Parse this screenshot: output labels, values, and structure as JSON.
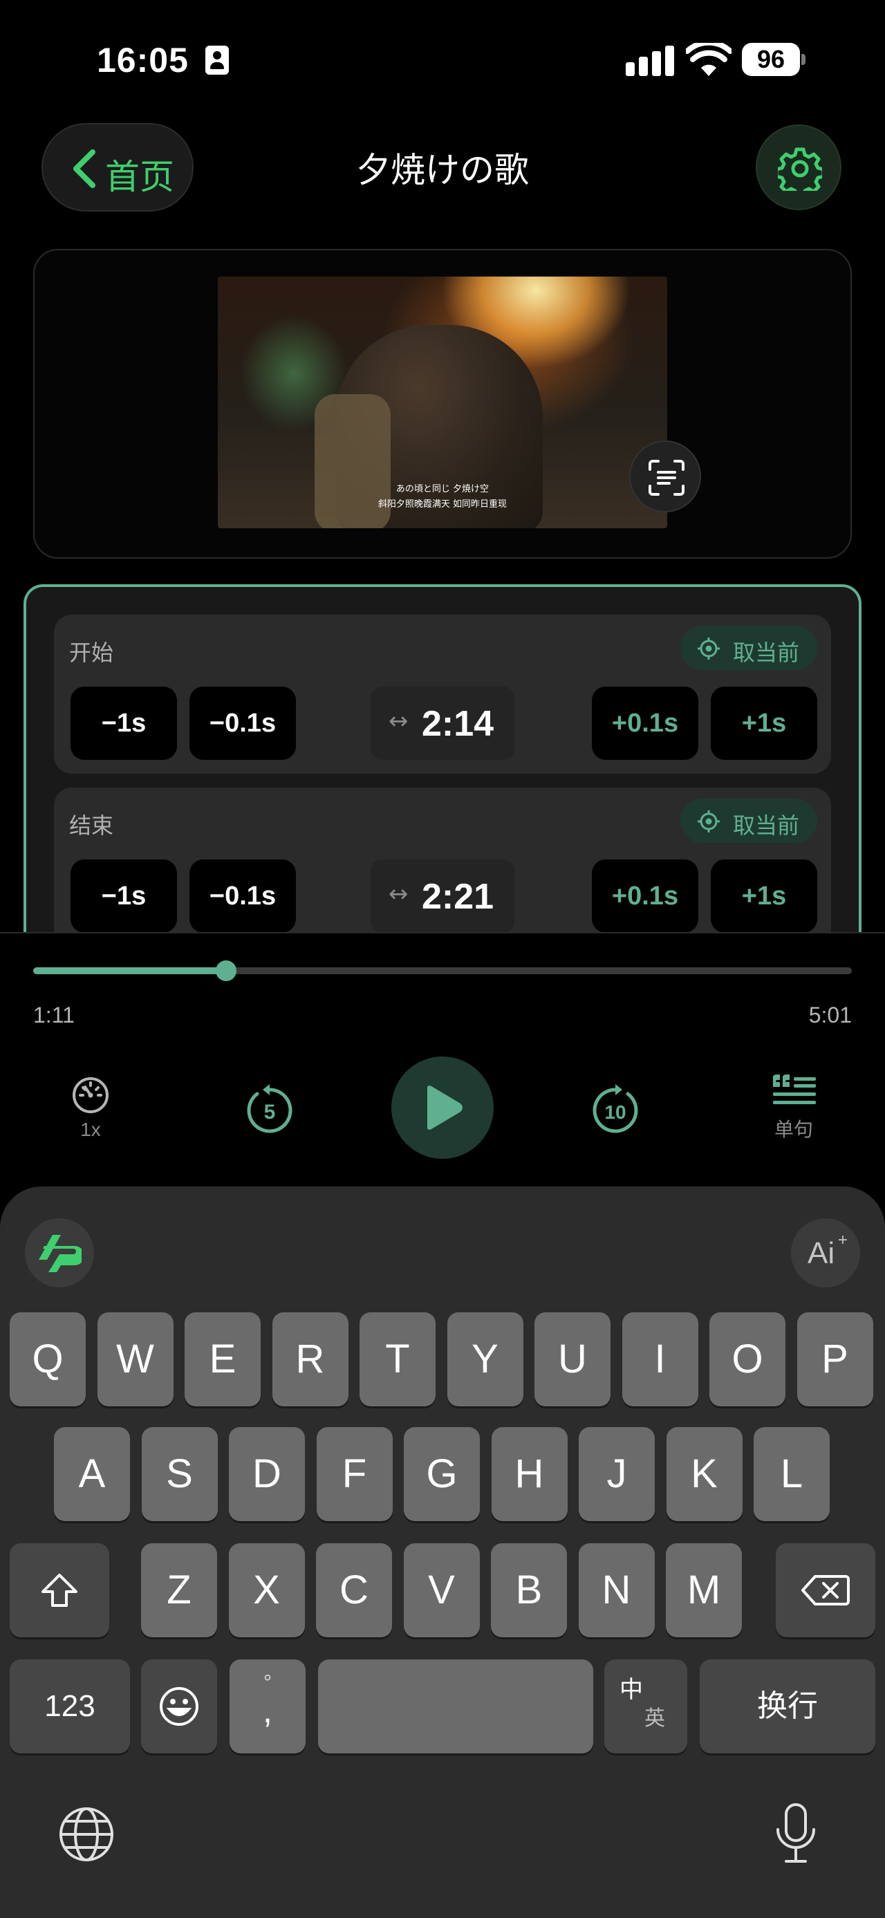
{
  "status_bar": {
    "time": "16:05",
    "battery": "96"
  },
  "header": {
    "back_label": "首页",
    "title": "夕焼けの歌"
  },
  "video": {
    "subtitle_ja": "あの頃と同じ 夕焼け空",
    "subtitle_zh": "斜阳夕照晚霞满天 如同昨日重现"
  },
  "range": {
    "take_current_label": "取当前",
    "start": {
      "label": "开始",
      "time": "2:14",
      "buttons": [
        "−1s",
        "−0.1s",
        "+0.1s",
        "+1s"
      ]
    },
    "end": {
      "label": "结束",
      "time": "2:21",
      "buttons": [
        "−1s",
        "−0.1s",
        "+0.1s",
        "+1s"
      ]
    },
    "arrow": "↔"
  },
  "player": {
    "current_time": "1:11",
    "total_time": "5:01",
    "progress_fraction": 0.236,
    "speed_label": "1x",
    "rewind_seconds": "5",
    "forward_seconds": "10",
    "sentence_label": "单句"
  },
  "keyboard": {
    "row1": [
      "Q",
      "W",
      "E",
      "R",
      "T",
      "Y",
      "U",
      "I",
      "O",
      "P"
    ],
    "row2": [
      "A",
      "S",
      "D",
      "F",
      "G",
      "H",
      "J",
      "K",
      "L"
    ],
    "row3": [
      "Z",
      "X",
      "C",
      "V",
      "B",
      "N",
      "M"
    ],
    "numbers_label": "123",
    "punct_top": "°",
    "punct_bottom": ",",
    "lang_top": "中",
    "lang_bottom": "英",
    "return_label": "换行",
    "ai_label": "Ai",
    "ai_spark": "+"
  },
  "colors": {
    "accent": "#5fb090",
    "back_green": "#3ecf6e",
    "keyboard_bg": "#2c2c2c",
    "key_bg": "#6b6b6b"
  },
  "icons": [
    "contact-card-icon",
    "signal-icon",
    "wifi-icon",
    "battery-icon",
    "chevron-left-icon",
    "gear-icon",
    "scan-text-icon",
    "crosshair-icon",
    "speedometer-icon",
    "rewind-5-icon",
    "play-icon",
    "forward-10-icon",
    "sentence-icon",
    "app-logo-icon",
    "shift-icon",
    "backspace-icon",
    "emoji-icon",
    "globe-icon",
    "microphone-icon"
  ]
}
